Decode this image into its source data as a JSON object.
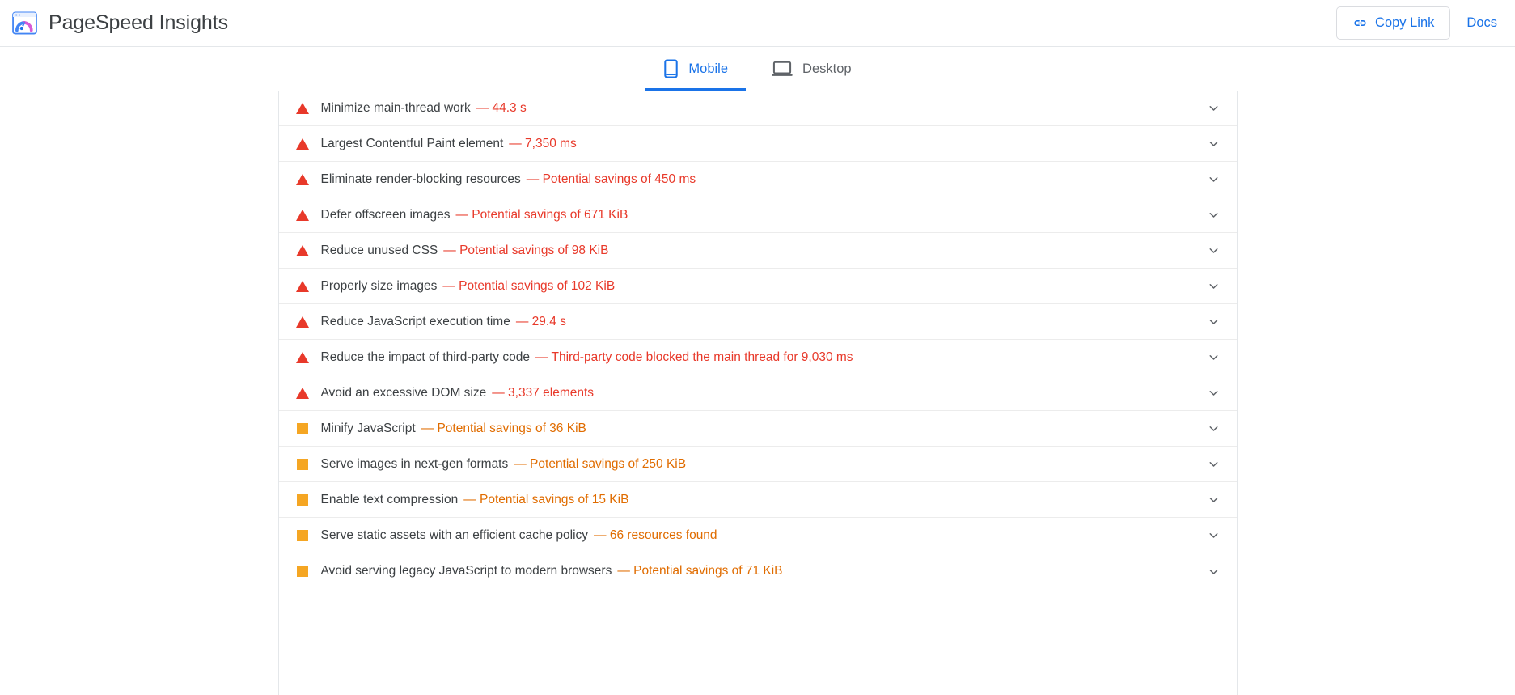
{
  "header": {
    "logo_icon": "pagespeed-insights-logo",
    "title": "PageSpeed Insights",
    "copy_link": {
      "icon": "link-icon",
      "label": "Copy Link"
    },
    "docs": {
      "label": "Docs"
    }
  },
  "tabs": [
    {
      "id": "mobile",
      "label": "Mobile",
      "icon": "mobile-phone-icon",
      "active": true
    },
    {
      "id": "desktop",
      "label": "Desktop",
      "icon": "desktop-monitor-icon",
      "active": false
    }
  ],
  "colors": {
    "accent": "#1a73e8",
    "error": "#e8392a",
    "warning_icon": "#f5a623",
    "warning_text": "#e06c00",
    "text": "#3c4043"
  },
  "audits": [
    {
      "severity": "error",
      "icon": "red-triangle-icon",
      "title": "Minimize main-thread work",
      "metric": "— 44.3 s",
      "expand_icon": "chevron-down-icon"
    },
    {
      "severity": "error",
      "icon": "red-triangle-icon",
      "title": "Largest Contentful Paint element",
      "metric": "— 7,350 ms",
      "expand_icon": "chevron-down-icon"
    },
    {
      "severity": "error",
      "icon": "red-triangle-icon",
      "title": "Eliminate render-blocking resources",
      "metric": "— Potential savings of 450 ms",
      "expand_icon": "chevron-down-icon"
    },
    {
      "severity": "error",
      "icon": "red-triangle-icon",
      "title": "Defer offscreen images",
      "metric": "— Potential savings of 671 KiB",
      "expand_icon": "chevron-down-icon"
    },
    {
      "severity": "error",
      "icon": "red-triangle-icon",
      "title": "Reduce unused CSS",
      "metric": "— Potential savings of 98 KiB",
      "expand_icon": "chevron-down-icon"
    },
    {
      "severity": "error",
      "icon": "red-triangle-icon",
      "title": "Properly size images",
      "metric": "— Potential savings of 102 KiB",
      "expand_icon": "chevron-down-icon"
    },
    {
      "severity": "error",
      "icon": "red-triangle-icon",
      "title": "Reduce JavaScript execution time",
      "metric": "— 29.4 s",
      "expand_icon": "chevron-down-icon"
    },
    {
      "severity": "error",
      "icon": "red-triangle-icon",
      "title": "Reduce the impact of third-party code",
      "metric": "— Third-party code blocked the main thread for 9,030 ms",
      "expand_icon": "chevron-down-icon"
    },
    {
      "severity": "error",
      "icon": "red-triangle-icon",
      "title": "Avoid an excessive DOM size",
      "metric": "— 3,337 elements",
      "expand_icon": "chevron-down-icon"
    },
    {
      "severity": "warning",
      "icon": "orange-square-icon",
      "title": "Minify JavaScript",
      "metric": "— Potential savings of 36 KiB",
      "expand_icon": "chevron-down-icon"
    },
    {
      "severity": "warning",
      "icon": "orange-square-icon",
      "title": "Serve images in next-gen formats",
      "metric": "— Potential savings of 250 KiB",
      "expand_icon": "chevron-down-icon"
    },
    {
      "severity": "warning",
      "icon": "orange-square-icon",
      "title": "Enable text compression",
      "metric": "— Potential savings of 15 KiB",
      "expand_icon": "chevron-down-icon"
    },
    {
      "severity": "warning",
      "icon": "orange-square-icon",
      "title": "Serve static assets with an efficient cache policy",
      "metric": "— 66 resources found",
      "expand_icon": "chevron-down-icon"
    },
    {
      "severity": "warning",
      "icon": "orange-square-icon",
      "title": "Avoid serving legacy JavaScript to modern browsers",
      "metric": "— Potential savings of 71 KiB",
      "expand_icon": "chevron-down-icon"
    }
  ]
}
